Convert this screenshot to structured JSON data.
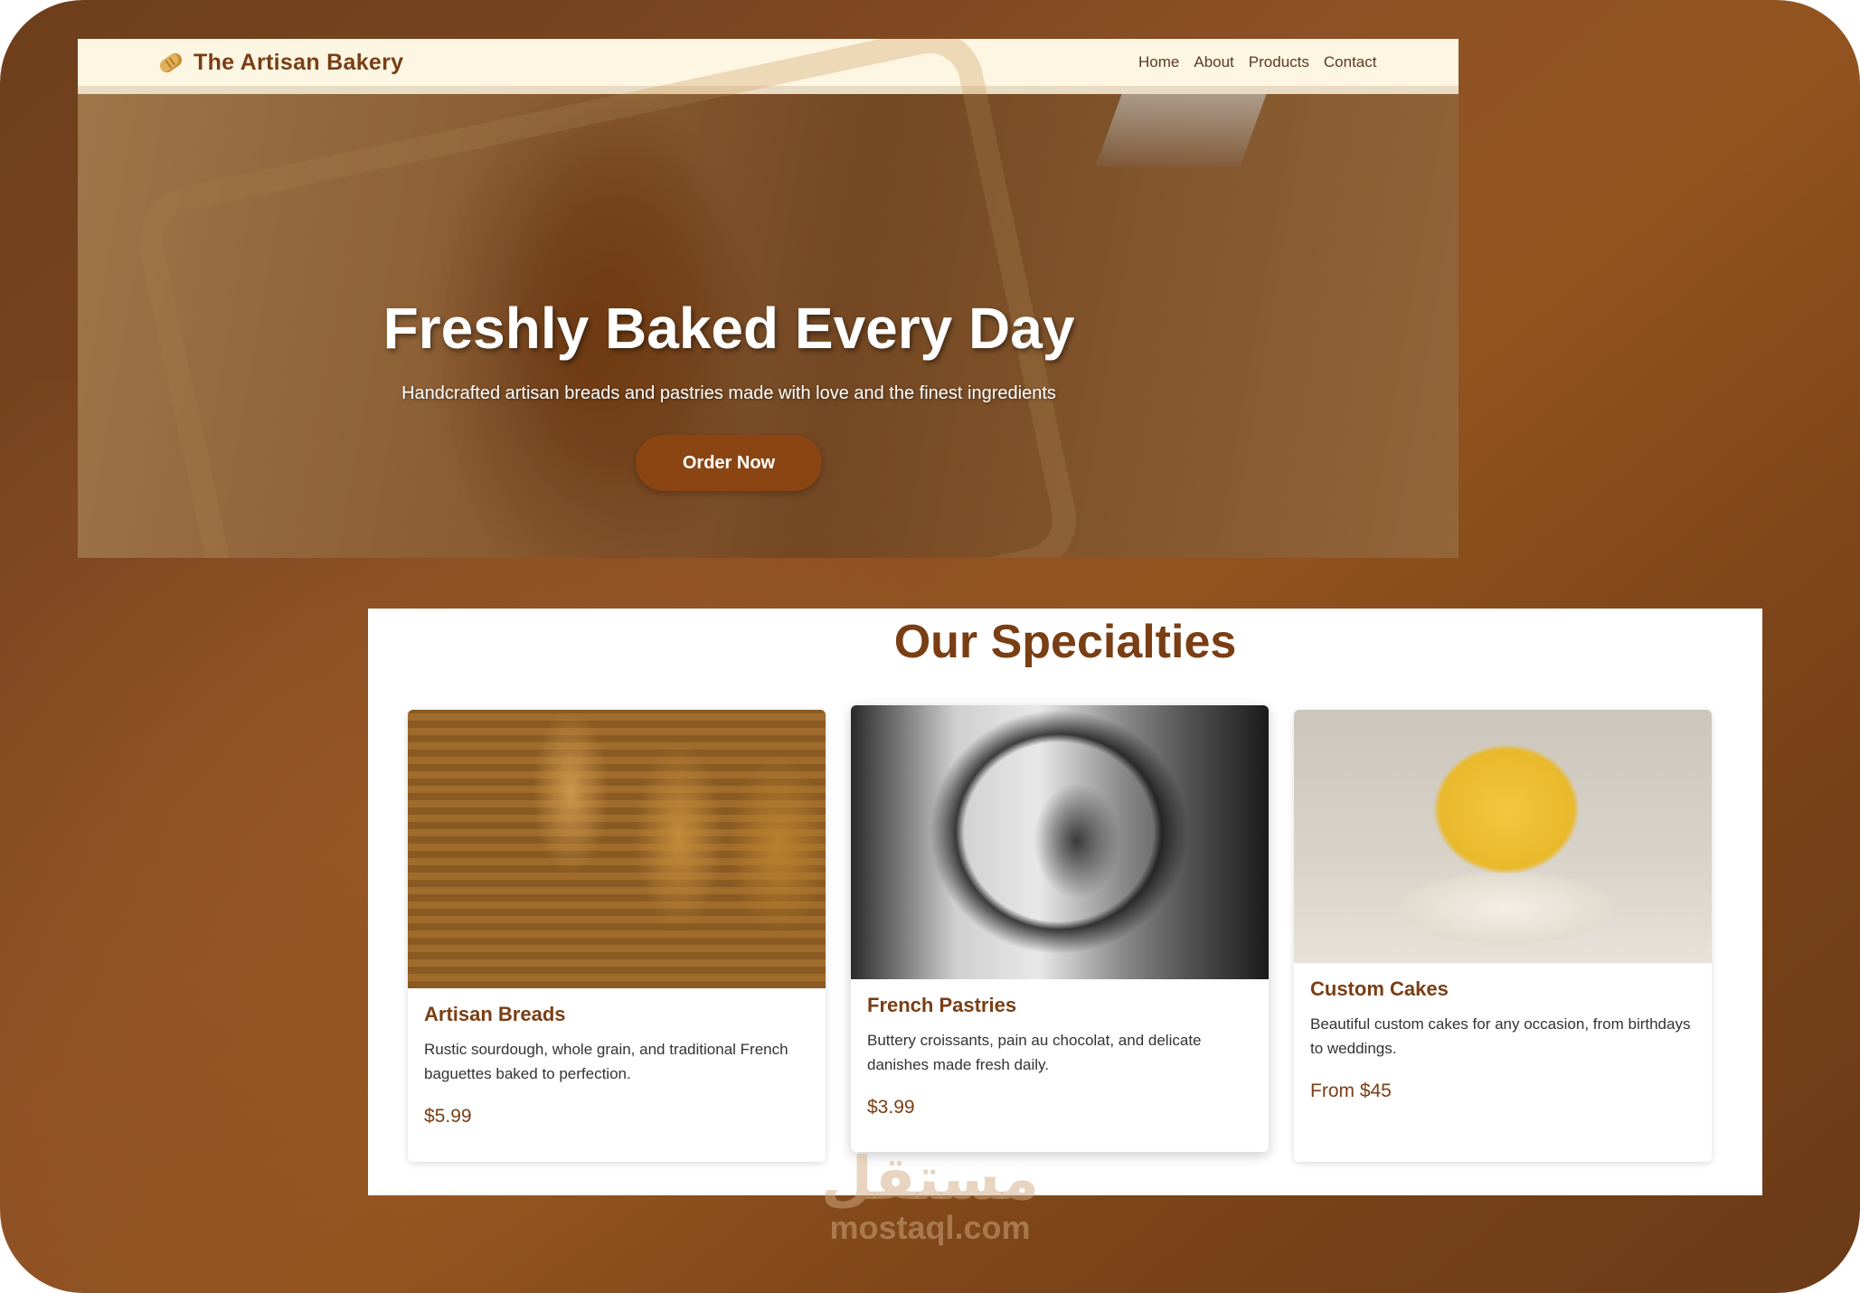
{
  "header": {
    "brand_icon": "bread-icon",
    "brand_title": "The Artisan Bakery",
    "nav": [
      {
        "label": "Home"
      },
      {
        "label": "About"
      },
      {
        "label": "Products"
      },
      {
        "label": "Contact"
      }
    ]
  },
  "hero": {
    "title": "Freshly Baked Every Day",
    "subtitle": "Handcrafted artisan breads and pastries made with love and the finest ingredients",
    "cta_label": "Order Now"
  },
  "specialties": {
    "title": "Our Specialties",
    "cards": [
      {
        "title": "Artisan Breads",
        "description": "Rustic sourdough, whole grain, and traditional French baguettes baked to perfection.",
        "price": "$5.99"
      },
      {
        "title": "French Pastries",
        "description": "Buttery croissants, pain au chocolat, and delicate danishes made fresh daily.",
        "price": "$3.99"
      },
      {
        "title": "Custom Cakes",
        "description": "Beautiful custom cakes for any occasion, from birthdays to weddings.",
        "price": "From $45"
      }
    ]
  },
  "watermark": {
    "arabic": "مستقل",
    "latin": "mostaql.com"
  },
  "colors": {
    "accent": "#8b4513",
    "heading": "#7a3e14",
    "navbar_bg": "#fdf6e3",
    "frame_bg": "#7a4520"
  }
}
